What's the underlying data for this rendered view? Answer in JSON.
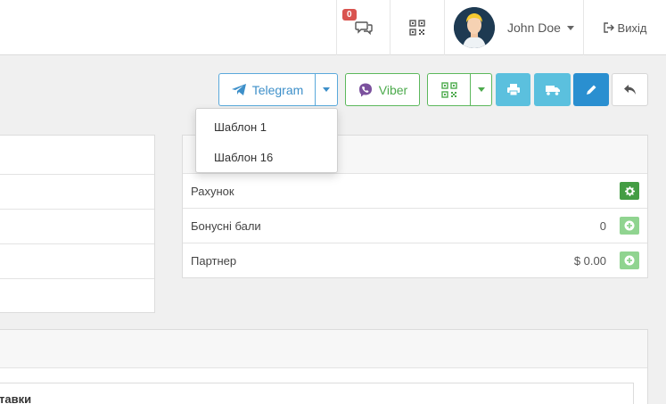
{
  "header": {
    "notifications_count": "0",
    "user_name": "John Doe",
    "exit_label": "Вихід",
    "icons": [
      "chat-icon",
      "qr-icon",
      "user-avatar",
      "sign-out-icon"
    ]
  },
  "toolbar": {
    "telegram_label": "Telegram",
    "viber_label": "Viber",
    "colors": {
      "telegram": "#3d8fc9",
      "viber": "#7b519d",
      "green": "#5cb85c",
      "info": "#5bc0de",
      "primary": "#2a8fd0"
    }
  },
  "telegram_menu": {
    "items": [
      "Шаблон 1",
      "Шаблон 16"
    ]
  },
  "info_panel": {
    "rows": [
      {
        "label": "Рахунок",
        "value": ""
      },
      {
        "label": "Бонусні бали",
        "value": "0"
      },
      {
        "label": "Партнер",
        "value": "$ 0.00"
      }
    ]
  },
  "bottom_panel": {
    "partial_title": "тавки"
  }
}
